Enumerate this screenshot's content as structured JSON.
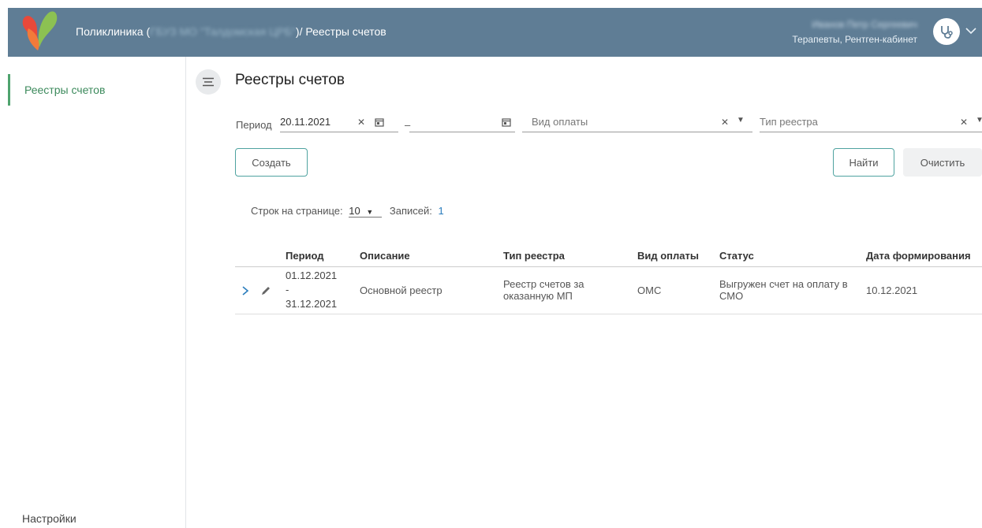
{
  "header": {
    "breadcrumb_prefix": "Поликлиника (",
    "breadcrumb_org": "ГБУЗ МО \"Талдомская ЦРБ\"",
    "breadcrumb_suffix": ")/ Реестры счетов",
    "user_name": "Иванов Петр Сергеевич",
    "user_role": "Терапевты, Рентген-кабинет",
    "avatar_icon": "stethoscope-icon",
    "colors": {
      "bar": "#5f7d95",
      "accent": "#4fa36e"
    }
  },
  "sidebar": {
    "items": [
      {
        "label": "Реестры счетов",
        "active": true
      }
    ],
    "settings_label": "Настройки"
  },
  "page": {
    "title": "Реестры счетов"
  },
  "filters": {
    "period_label": "Период",
    "period_from": "20.11.2021",
    "period_to": "",
    "dash": "–",
    "payment_placeholder": "Вид оплаты",
    "registry_type_placeholder": "Тип реестра"
  },
  "buttons": {
    "create": "Создать",
    "find": "Найти",
    "clear": "Очистить"
  },
  "pager": {
    "rows_label": "Строк на странице:",
    "rows_value": "10",
    "records_label": "Записей:",
    "records_value": "1"
  },
  "table": {
    "headers": [
      "Период",
      "Описание",
      "Тип реестра",
      "Вид оплаты",
      "Статус",
      "Дата формирования"
    ],
    "rows": [
      {
        "period_from": "01.12.2021",
        "period_sep": "-",
        "period_to": "31.12.2021",
        "description": "Основной реестр",
        "registry_type": "Реестр счетов за оказанную МП",
        "payment": "ОМС",
        "status": "Выгружен счет на оплату в СМО",
        "date": "10.12.2021"
      }
    ]
  }
}
